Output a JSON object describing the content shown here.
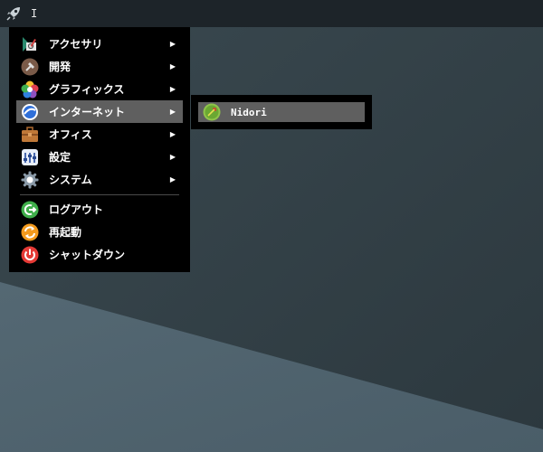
{
  "taskbar": {
    "text": "I"
  },
  "menu": {
    "items": [
      {
        "label": "アクセサリ",
        "icon": "accessories-icon",
        "arrow": "▶"
      },
      {
        "label": "開発",
        "icon": "development-icon",
        "arrow": "▶"
      },
      {
        "label": "グラフィックス",
        "icon": "graphics-icon",
        "arrow": "▶"
      },
      {
        "label": "インターネット",
        "icon": "internet-icon",
        "arrow": "▶",
        "active": true
      },
      {
        "label": "オフィス",
        "icon": "office-icon",
        "arrow": "▶"
      },
      {
        "label": "設定",
        "icon": "settings-icon",
        "arrow": "▶"
      },
      {
        "label": "システム",
        "icon": "system-icon",
        "arrow": "▶"
      }
    ],
    "actions": [
      {
        "label": "ログアウト",
        "icon": "logout-icon"
      },
      {
        "label": "再起動",
        "icon": "reboot-icon"
      },
      {
        "label": "シャットダウン",
        "icon": "shutdown-icon"
      }
    ]
  },
  "submenu": {
    "items": [
      {
        "label": "Nidori",
        "icon": "midori-icon"
      }
    ]
  },
  "colors": {
    "taskbar": "#1d2429",
    "menu_bg": "#000000",
    "active_bg": "#5f5f5f",
    "desktop_dark": "#2f3b42",
    "desktop_light": "#4f626d"
  }
}
